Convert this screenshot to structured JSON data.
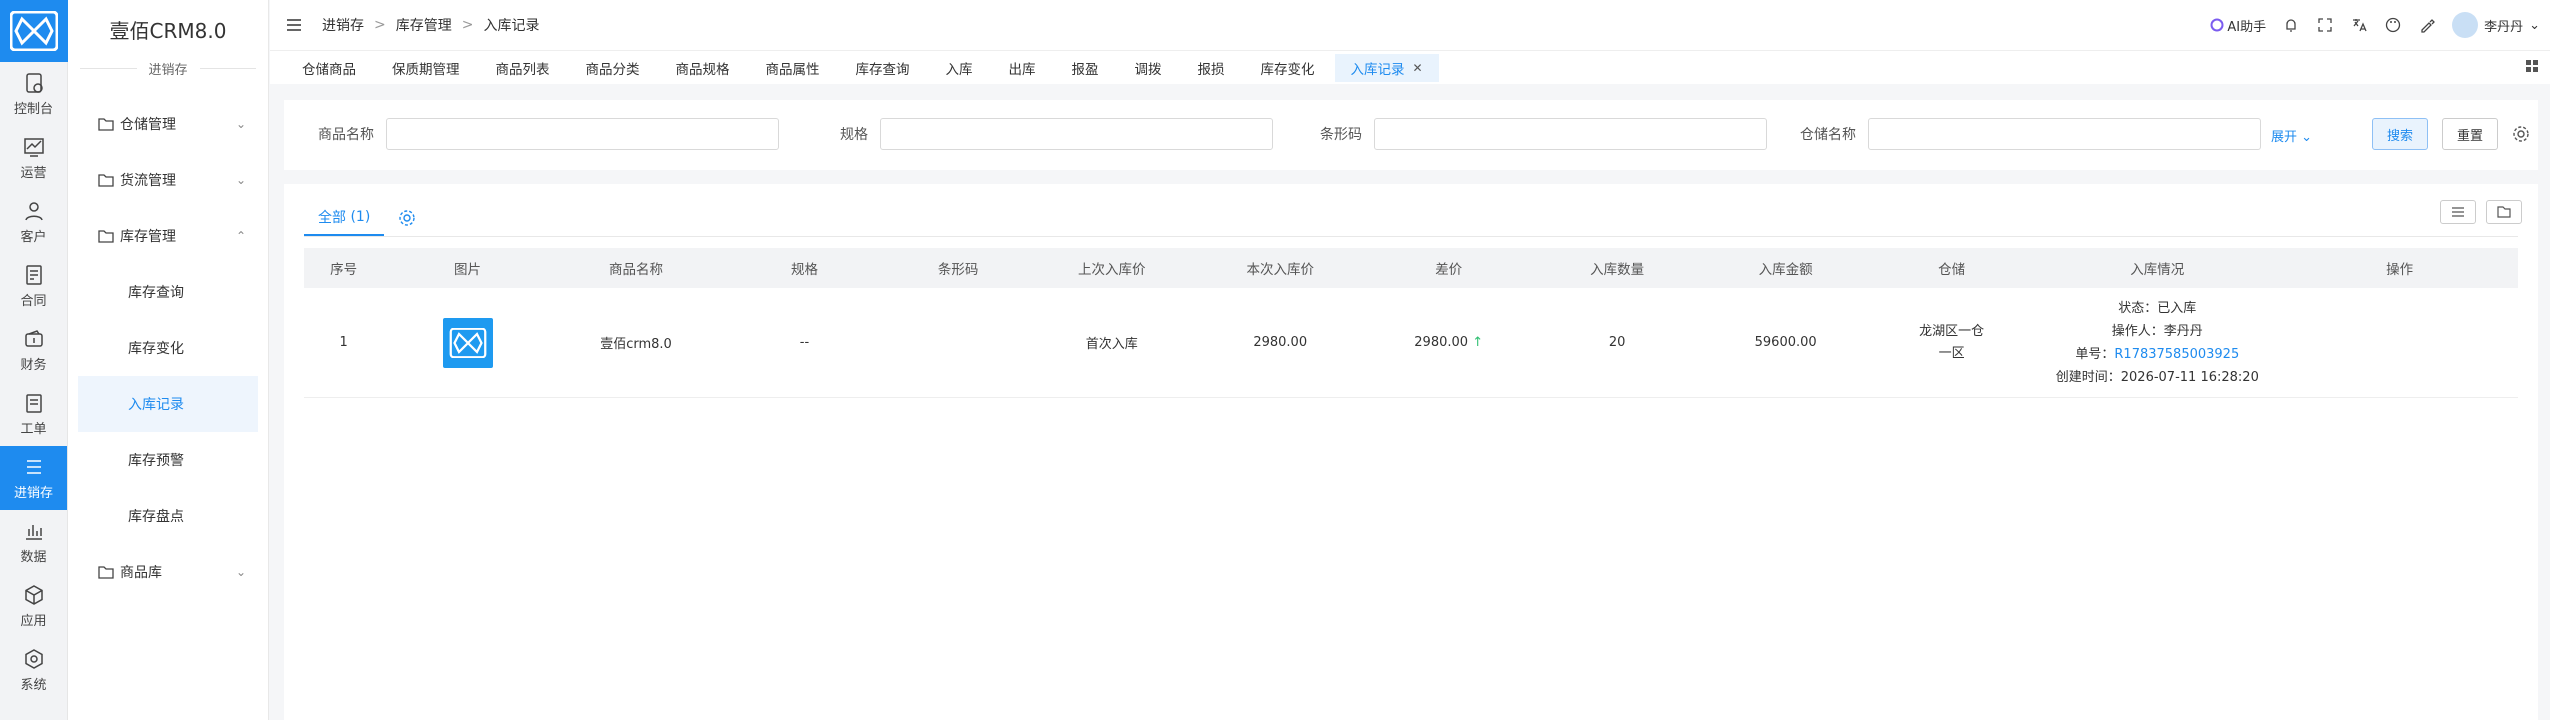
{
  "app": {
    "brand": "壹佰CRM8.0",
    "module": "进销存"
  },
  "rail": [
    {
      "label": "控制台",
      "icon": "dashboard-icon"
    },
    {
      "label": "运营",
      "icon": "trend-icon"
    },
    {
      "label": "客户",
      "icon": "user-icon"
    },
    {
      "label": "合同",
      "icon": "contract-icon"
    },
    {
      "label": "财务",
      "icon": "wallet-icon"
    },
    {
      "label": "工单",
      "icon": "ticket-icon"
    },
    {
      "label": "进销存",
      "icon": "list-icon",
      "active": true
    },
    {
      "label": "数据",
      "icon": "chart-icon"
    },
    {
      "label": "应用",
      "icon": "cube-icon"
    },
    {
      "label": "系统",
      "icon": "system-icon"
    }
  ],
  "sidebar": {
    "groups": [
      {
        "label": "仓储管理",
        "chevron": "⌄"
      },
      {
        "label": "货流管理",
        "chevron": "⌄"
      },
      {
        "label": "库存管理",
        "chevron": "⌃"
      },
      {
        "label": "商品库",
        "chevron": "⌄"
      }
    ],
    "sub": [
      "库存查询",
      "库存变化",
      "入库记录",
      "库存预警",
      "库存盘点"
    ]
  },
  "breadcrumb": [
    "进销存",
    "库存管理",
    "入库记录"
  ],
  "topbar": {
    "ai": "AI助手",
    "user": "李丹丹"
  },
  "tabs": [
    "仓储商品",
    "保质期管理",
    "商品列表",
    "商品分类",
    "商品规格",
    "商品属性",
    "库存查询",
    "入库",
    "出库",
    "报盈",
    "调拨",
    "报损",
    "库存变化",
    "入库记录"
  ],
  "search": {
    "fields": [
      "商品名称",
      "规格",
      "条形码",
      "仓储名称"
    ],
    "expand": "展开",
    "search_btn": "搜索",
    "reset_btn": "重置"
  },
  "list": {
    "tab_all": "全部",
    "count": "(1)",
    "columns": [
      "序号",
      "图片",
      "商品名称",
      "规格",
      "条形码",
      "上次入库价",
      "本次入库价",
      "差价",
      "入库数量",
      "入库金额",
      "仓储",
      "入库情况",
      "操作"
    ],
    "rows": [
      {
        "index": "1",
        "name": "壹佰crm8.0",
        "spec": "--",
        "barcode": "",
        "last_price": "首次入库",
        "current_price": "2980.00",
        "diff": "2980.00",
        "diff_arrow": "↑",
        "qty": "20",
        "amount": "59600.00",
        "warehouse_line1": "龙湖区一仓",
        "warehouse_line2": "一区",
        "status": "状态：已入库",
        "operator": "操作人：李丹丹",
        "order_label": "单号：",
        "order_no": "R17837585003925",
        "created": "创建时间：2026-07-11 16:28:20",
        "action": ""
      }
    ]
  },
  "colors": {
    "accent": "#1e8bef",
    "up": "#2fbf71"
  }
}
